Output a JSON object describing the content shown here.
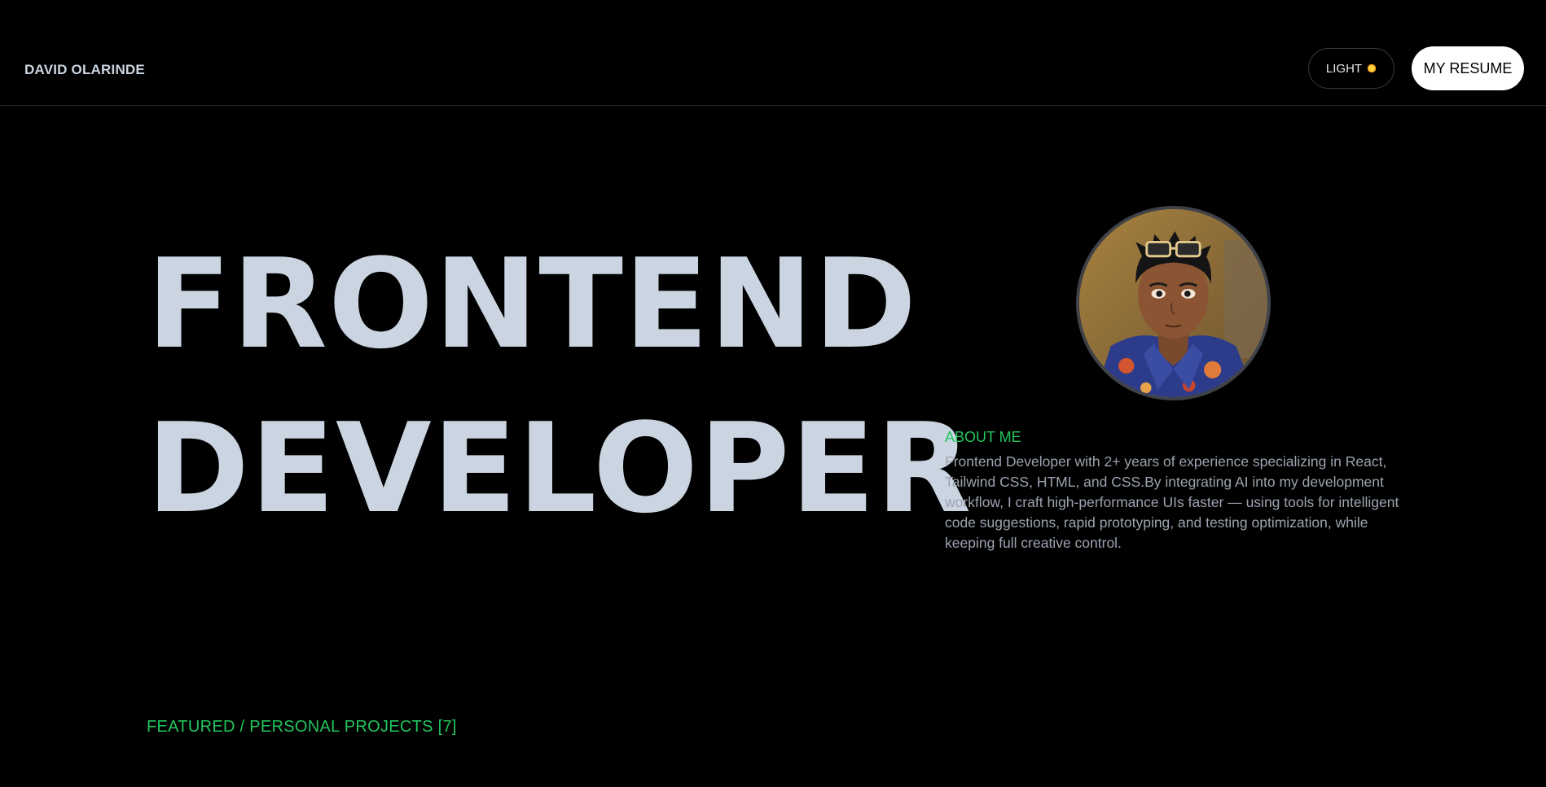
{
  "header": {
    "brand": "DAVID OLARINDE",
    "theme_toggle_label": "LIGHT",
    "theme_toggle_icon": "sun-icon",
    "resume_label": "MY RESUME"
  },
  "hero": {
    "line1": "FRONTEND",
    "line2": "DEVELOPER"
  },
  "about": {
    "title": "ABOUT ME",
    "text": "Frontend Developer with 2+ years of experience specializing in React, Tailwind CSS, HTML, and CSS.By integrating AI into my development workflow, I craft high-performance UIs faster — using tools for intelligent code suggestions, rapid prototyping, and testing optimization, while keeping full creative control."
  },
  "projects": {
    "title": "FEATURED / PERSONAL PROJECTS [7]"
  },
  "colors": {
    "background": "#000000",
    "hero_text": "#cbd5e1",
    "accent": "#22c55e",
    "muted_text": "#9ca3af"
  }
}
